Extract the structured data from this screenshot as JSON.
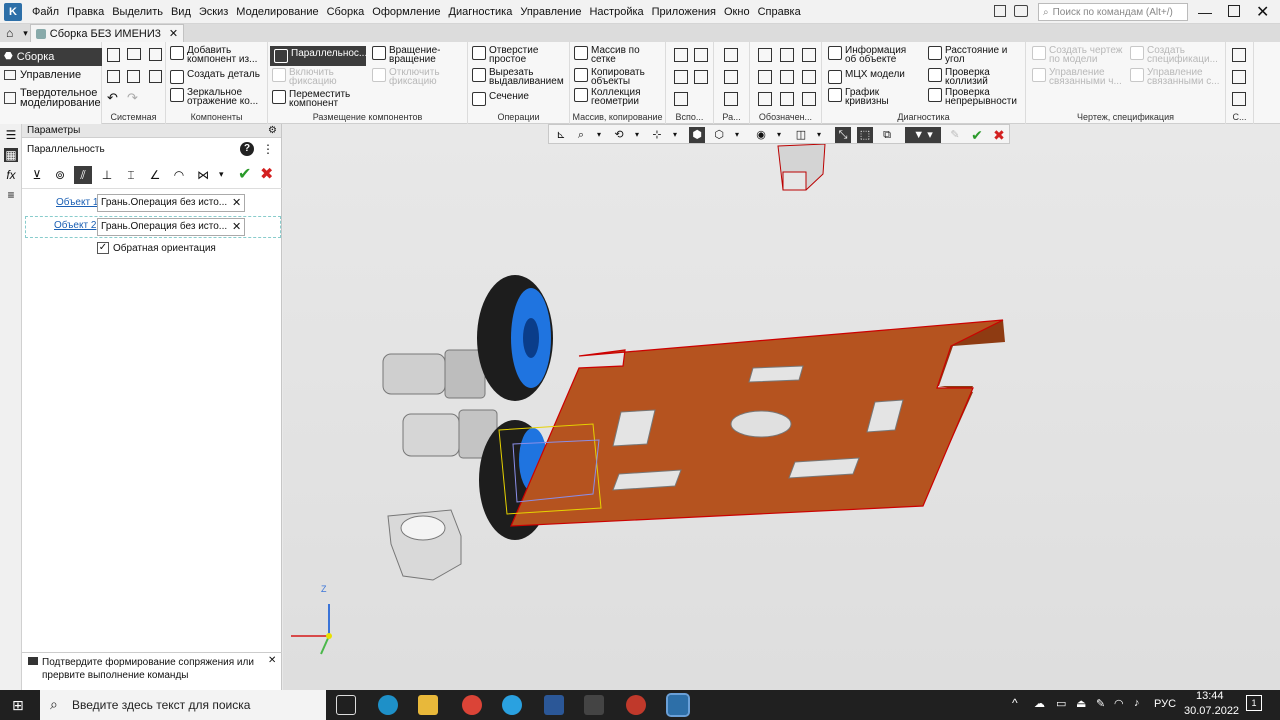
{
  "menubar": {
    "items": [
      "Файл",
      "Правка",
      "Выделить",
      "Вид",
      "Эскиз",
      "Моделирование",
      "Сборка",
      "Оформление",
      "Диагностика",
      "Управление",
      "Настройка",
      "Приложения",
      "Окно",
      "Справка"
    ],
    "search_placeholder": "Поиск по командам (Alt+/)"
  },
  "tab": {
    "label": "Сборка БЕЗ ИМЕНИ3"
  },
  "sidebar": {
    "items": [
      "Сборка",
      "Управление",
      "Твердотельное\nмоделирование"
    ]
  },
  "ribbon": {
    "groups": [
      "Системная",
      "Компоненты",
      "Размещение компонентов",
      "Операции",
      "Массив, копирование",
      "Вспо...",
      "Ра...",
      "Обозначен...",
      "Диагностика",
      "Чертеж, спецификация",
      "С..."
    ],
    "components": [
      "Добавить\nкомпонент из...",
      "Создать деталь",
      "Зеркальное\nотражение ко..."
    ],
    "placement": [
      "Параллельнос...",
      "Вращение-\nвращение",
      "Включить\nфиксацию",
      "Отключить\nфиксацию",
      "Переместить\nкомпонент"
    ],
    "operations": [
      "Отверстие\nпростое",
      "Вырезать\nвыдавливанием",
      "Сечение"
    ],
    "array": [
      "Массив по\nсетке",
      "Копировать\nобъекты",
      "Коллекция\nгеометрии"
    ],
    "diagnostics": [
      "Информация\nоб объекте",
      "МЦХ модели",
      "График\nкривизны",
      "Расстояние и\nугол",
      "Проверка\nколлизий",
      "Проверка\nнепрерывности"
    ],
    "drawing": [
      "Создать чертеж\nпо модели",
      "Создать\nспецификаци...",
      "Управление\nсвязанными ч...",
      "Управление\nсвязанными с..."
    ]
  },
  "panel": {
    "title": "Параметры",
    "subtitle": "Параллельность",
    "object1_label": "Объект 1",
    "object1_value": "Грань.Операция без исто...",
    "object2_label": "Объект 2",
    "object2_value": "Грань.Операция без исто...",
    "checkbox_label": "Обратная ориентация",
    "checkbox_checked": true,
    "hint": "Подтвердите формирование сопряжения или\nпрервите выполнение команды"
  },
  "axes": {
    "z": "Z"
  },
  "taskbar": {
    "search_placeholder": "Введите здесь текст для поиска",
    "lang": "РУС",
    "time": "13:44",
    "date": "30.07.2022",
    "notification_count": "1"
  },
  "colors": {
    "plate": "#b5531f",
    "wheel": "#1f74e0",
    "accent": "#2d6fa8",
    "taskbar": "#202020"
  }
}
